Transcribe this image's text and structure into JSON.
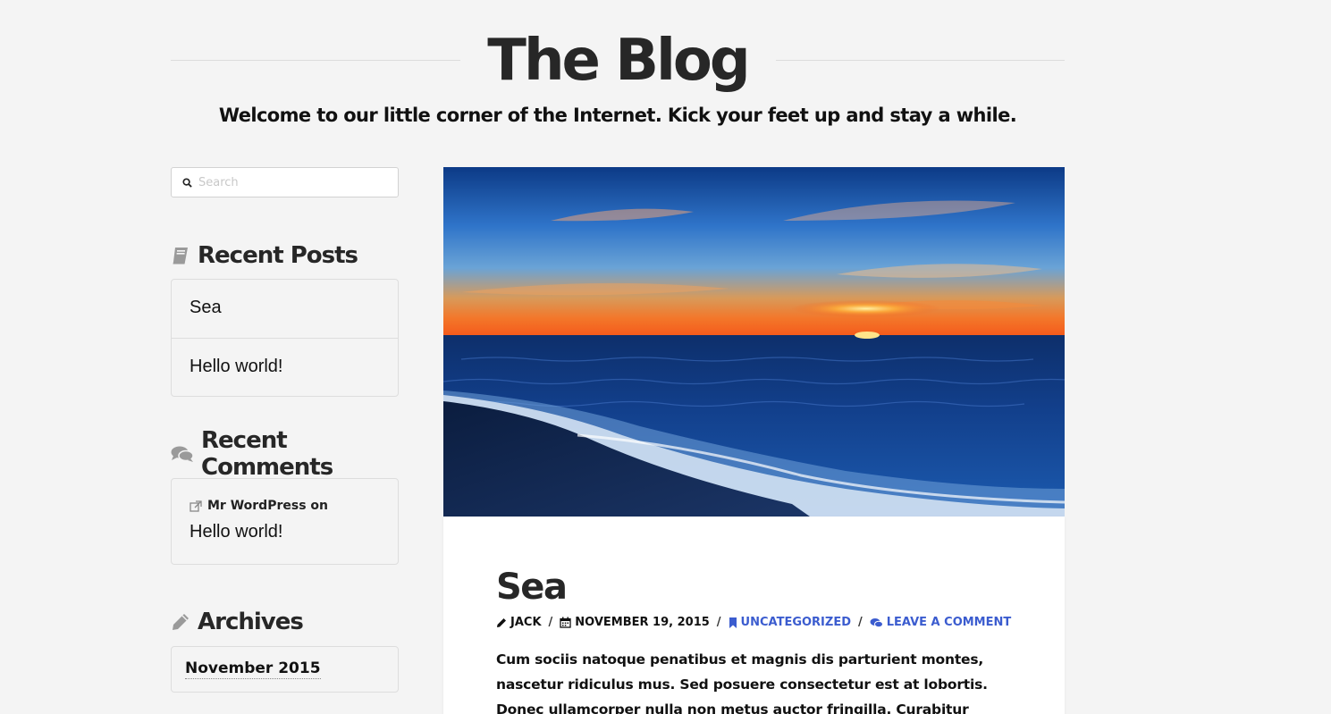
{
  "site": {
    "title": "The Blog",
    "tagline": "Welcome to our little corner of the Internet. Kick your feet up and stay a while."
  },
  "sidebar": {
    "search": {
      "placeholder": "Search",
      "value": ""
    },
    "recent_posts": {
      "title": "Recent Posts",
      "icon": "book-icon",
      "items": [
        {
          "label": "Sea"
        },
        {
          "label": "Hello world!"
        }
      ]
    },
    "recent_comments": {
      "title": "Recent Comments",
      "icon": "comments-icon",
      "item": {
        "author_line": "Mr WordPress on",
        "post": "Hello world!"
      }
    },
    "archives": {
      "title": "Archives",
      "icon": "pencil-icon",
      "items": [
        {
          "label": "November 2015"
        }
      ]
    }
  },
  "post": {
    "title": "Sea",
    "meta": {
      "author": "JACK",
      "date": "NOVEMBER 19, 2015",
      "category": "UNCATEGORIZED",
      "comments": "LEAVE A COMMENT"
    },
    "excerpt": "Cum sociis natoque penatibus et magnis dis parturient montes, nascetur ridiculus mus. Sed posuere consectetur est at lobortis. Donec ullamcorper nulla non metus auctor fringilla. Curabitur blandit tempus porttitor. Donec"
  },
  "colors": {
    "background": "#f4f4f4",
    "link_blue": "#3b5ccf",
    "text": "#111111"
  }
}
